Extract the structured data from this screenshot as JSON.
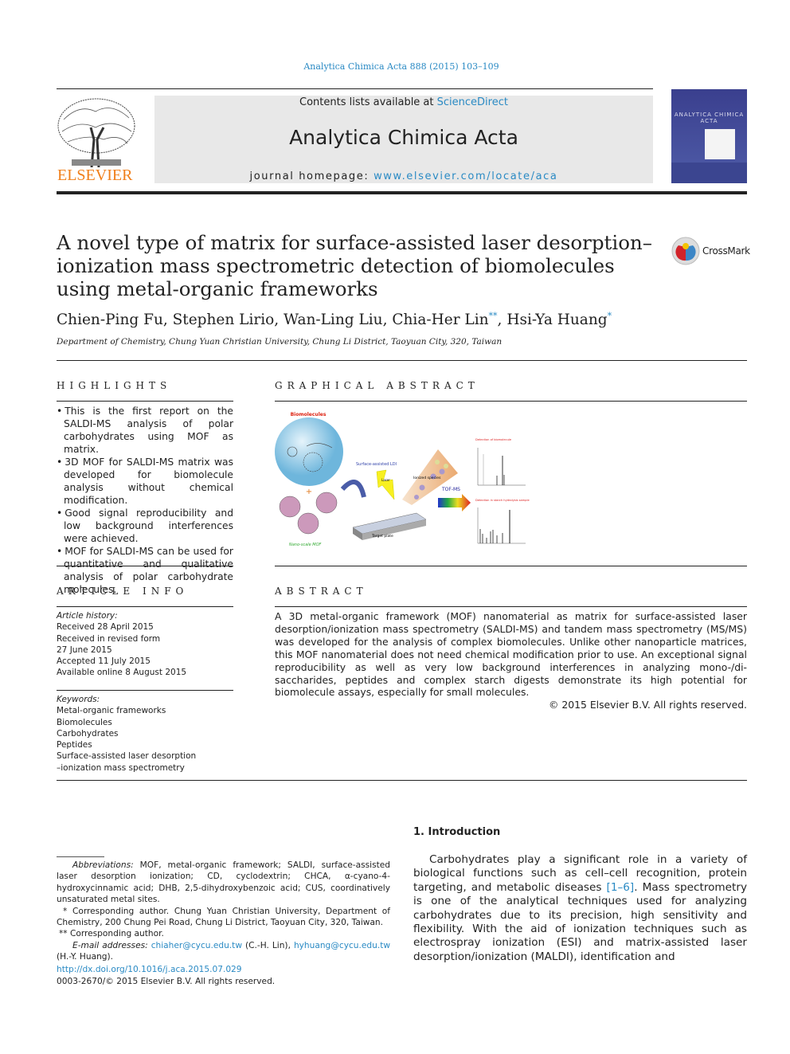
{
  "journal_ref": "Analytica Chimica Acta 888 (2015) 103–109",
  "masthead": {
    "contents_prefix": "Contents lists available at ",
    "contents_link": "ScienceDirect",
    "journal_title": "Analytica Chimica Acta",
    "homepage_prefix": "journal homepage: ",
    "homepage_link": "www.elsevier.com/locate/aca",
    "publisher_logo": "ELSEVIER",
    "cover_title": "ANALYTICA CHIMICA ACTA"
  },
  "article": {
    "title": "A novel type of matrix for surface-assisted laser desorption–ionization mass spectrometric detection of biomolecules using metal-organic frameworks",
    "authors_plain": "Chien-Ping Fu, Stephen Lirio, Wan-Ling Liu, Chia-Her Lin",
    "author_mark_1": "**",
    "author_last_sep": ", ",
    "author_last": "Hsi-Ya Huang",
    "author_mark_2": "*",
    "affiliation": "Department of Chemistry, Chung Yuan Christian University, Chung Li District, Taoyuan City, 320, Taiwan",
    "crossmark": "CrossMark"
  },
  "highlights": {
    "heading": "HIGHLIGHTS",
    "items": [
      "This is the first report on the SALDI-MS analysis of polar carbohydrates using MOF as matrix.",
      "3D MOF for SALDI-MS matrix was developed for biomolecule analysis without chemical modification.",
      "Good signal reproducibility and low background interferences were achieved.",
      "MOF for SALDI-MS can be used for quantitative and qualitative analysis of polar carbohydrate molecules."
    ]
  },
  "graphical_abstract": {
    "heading": "GRAPHICAL ABSTRACT",
    "labels": {
      "biomolecules": "Biomolecules",
      "nano_mof": "Nano-scale MOF",
      "saldi": "Surface-assisted LDI",
      "laser": "Laser",
      "ionized": "Ionized species",
      "tofms": "TOF-MS",
      "target": "Target plate",
      "detect1": "Detection of biomolecule",
      "detect2": "Detection in starch hydrolysis sample"
    }
  },
  "article_info": {
    "heading": "ARTICLE INFO",
    "history_label": "Article history:",
    "history": [
      "Received 28 April 2015",
      "Received in revised form",
      "27 June 2015",
      "Accepted 11 July 2015",
      "Available online 8 August 2015"
    ],
    "keywords_label": "Keywords:",
    "keywords": [
      "Metal-organic frameworks",
      "Biomolecules",
      "Carbohydrates",
      "Peptides",
      "Surface-assisted laser desorption",
      "–ionization mass spectrometry"
    ]
  },
  "abstract": {
    "heading": "ABSTRACT",
    "text": "A 3D metal-organic framework (MOF) nanomaterial as matrix for surface-assisted laser desorption/ionization mass spectrometry (SALDI-MS) and tandem mass spectrometry (MS/MS) was developed for the analysis of complex biomolecules. Unlike other nanoparticle matrices, this MOF nanomaterial does not need chemical modification prior to use. An exceptional signal reproducibility as well as very low background interferences in analyzing mono-/di-saccharides, peptides and complex starch digests demonstrate its high potential for biomolecule assays, especially for small molecules.",
    "copyright": "© 2015 Elsevier B.V. All rights reserved."
  },
  "introduction": {
    "heading": "1.  Introduction",
    "text_before": "Carbohydrates play a significant role in a variety of biological functions such as cell–cell recognition, protein targeting, and metabolic diseases ",
    "ref": "[1–6]",
    "text_after": ". Mass spectrometry is one of the analytical techniques used for analyzing carbohydrates due to its precision, high sensitivity and flexibility. With the aid of ionization techniques such as electrospray ionization (ESI) and matrix-assisted laser desorption/ionization (MALDI), identification and"
  },
  "footnotes": {
    "abbrev_label": "Abbreviations:",
    "abbrev_text": " MOF, metal-organic framework; SALDI, surface-assisted laser desorption ionization; CD, cyclodextrin; CHCA, α-cyano-4-hydroxycinnamic acid; DHB, 2,5-dihydroxybenzoic acid; CUS, coordinatively unsaturated metal sites.",
    "corr1": "* Corresponding author. Chung Yuan Christian University, Department of Chemistry, 200 Chung Pei Road, Chung Li District, Taoyuan City, 320, Taiwan.",
    "corr2": "** Corresponding author.",
    "email_label": "E-mail addresses:",
    "email1": "chiaher@cycu.edu.tw",
    "email1_who": " (C.-H. Lin), ",
    "email2": "hyhuang@cycu.edu.tw",
    "email2_who": " (H.-Y. Huang).",
    "doi": "http://dx.doi.org/10.1016/j.aca.2015.07.029",
    "issn": "0003-2670/© 2015 Elsevier B.V. All rights reserved."
  },
  "colors": {
    "link": "#2a8ac4",
    "elsevier_orange": "#f07f1a",
    "masthead_bg": "#e8e8e8"
  }
}
